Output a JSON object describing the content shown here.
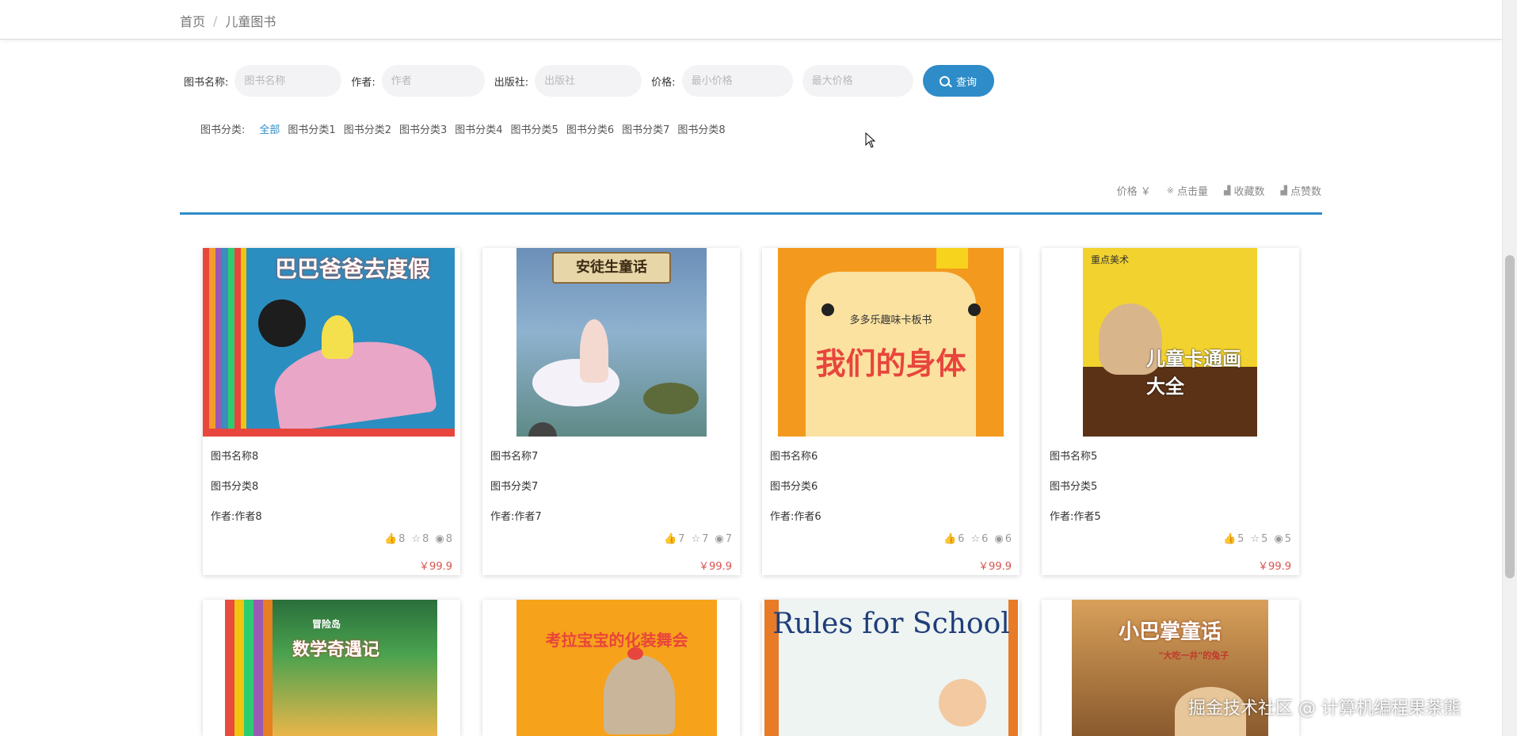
{
  "breadcrumb": {
    "home": "首页",
    "separator": "/",
    "current": "儿童图书"
  },
  "search": {
    "name_label": "图书名称:",
    "name_placeholder": "图书名称",
    "author_label": "作者:",
    "author_placeholder": "作者",
    "publisher_label": "出版社:",
    "publisher_placeholder": "出版社",
    "price_label": "价格:",
    "min_price_placeholder": "最小价格",
    "max_price_placeholder": "最大价格",
    "button_label": "查询",
    "button_color": "#2e8cc8"
  },
  "categories": {
    "label": "图书分类:",
    "items": [
      "全部",
      "图书分类1",
      "图书分类2",
      "图书分类3",
      "图书分类4",
      "图书分类5",
      "图书分类6",
      "图书分类7",
      "图书分类8"
    ],
    "active": "全部"
  },
  "sort": {
    "price": "价格 ￥",
    "clicks": "点击量",
    "favorites": "收藏数",
    "likes": "点赞数"
  },
  "books": [
    {
      "name": "图书名称8",
      "category": "图书分类8",
      "author": "作者:作者8",
      "likes": "8",
      "stars": "8",
      "views": "8",
      "price": "￥99.9",
      "cover_title": "巴巴爸爸去度假"
    },
    {
      "name": "图书名称7",
      "category": "图书分类7",
      "author": "作者:作者7",
      "likes": "7",
      "stars": "7",
      "views": "7",
      "price": "￥99.9",
      "cover_title": "安徒生童话"
    },
    {
      "name": "图书名称6",
      "category": "图书分类6",
      "author": "作者:作者6",
      "likes": "6",
      "stars": "6",
      "views": "6",
      "price": "￥99.9",
      "cover_title": "我们的身体",
      "cover_subtitle": "多多乐趣味卡板书"
    },
    {
      "name": "图书名称5",
      "category": "图书分类5",
      "author": "作者:作者5",
      "likes": "5",
      "stars": "5",
      "views": "5",
      "price": "￥99.9",
      "cover_title": "儿童卡通画大全",
      "cover_subtitle": "重点美术"
    },
    {
      "cover_title": "数学奇遇记",
      "cover_subtitle": "冒险岛"
    },
    {
      "cover_title": "考拉宝宝的化装舞会"
    },
    {
      "cover_title": "Rules for School"
    },
    {
      "cover_title": "小巴掌童话",
      "cover_subtitle": "\"大吃一井\"的兔子"
    }
  ],
  "watermark": "掘金技术社区 @ 计算机编程果茶熊"
}
